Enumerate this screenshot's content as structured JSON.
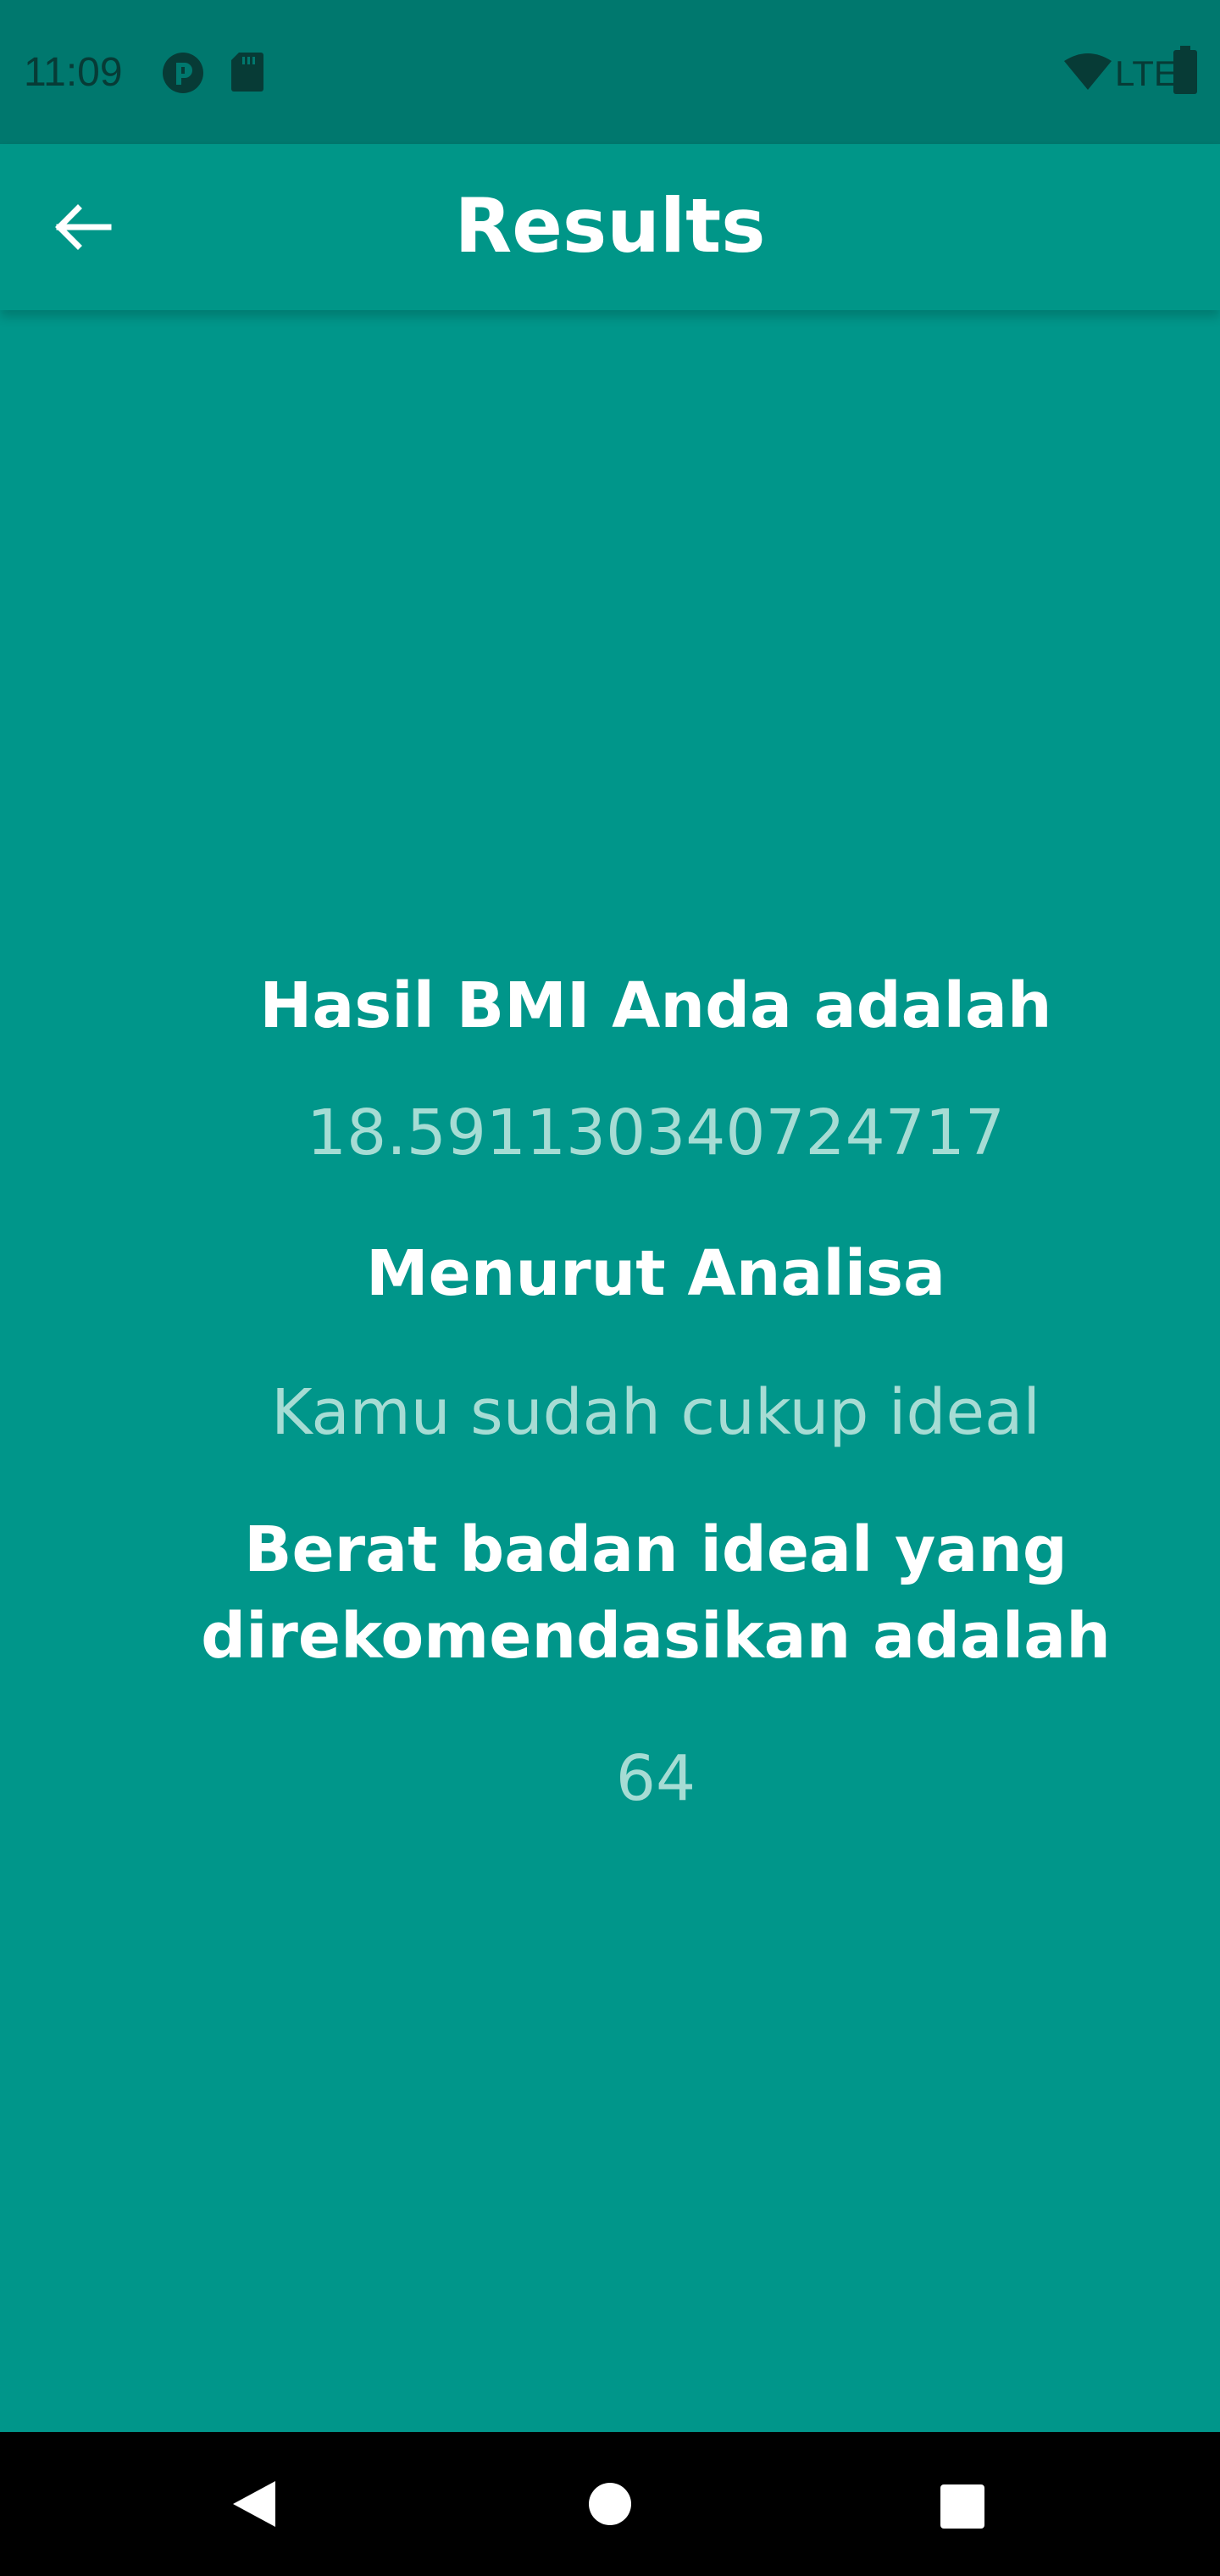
{
  "status_bar": {
    "time": "11:09",
    "network": "LTE",
    "icons": [
      "pocket-icon",
      "sd-card-icon",
      "wifi-icon",
      "battery-icon"
    ]
  },
  "app_bar": {
    "title": "Results",
    "back_icon": "arrow-back-icon"
  },
  "results": {
    "bmi_heading": "Hasil BMI Anda adalah",
    "bmi_value": "18.591130340724717",
    "analysis_heading": "Menurut Analisa",
    "analysis_value": "Kamu sudah cukup ideal",
    "ideal_weight_heading": "Berat badan ideal yang direkomendasikan adalah",
    "ideal_weight_value": "64"
  },
  "nav_bar": {
    "icons": [
      "back-triangle-icon",
      "home-circle-icon",
      "recents-square-icon"
    ]
  },
  "colors": {
    "primary": "#009688",
    "status_bar": "#00786e",
    "value_text": "#a6dcd4",
    "heading_text": "#ffffff"
  }
}
